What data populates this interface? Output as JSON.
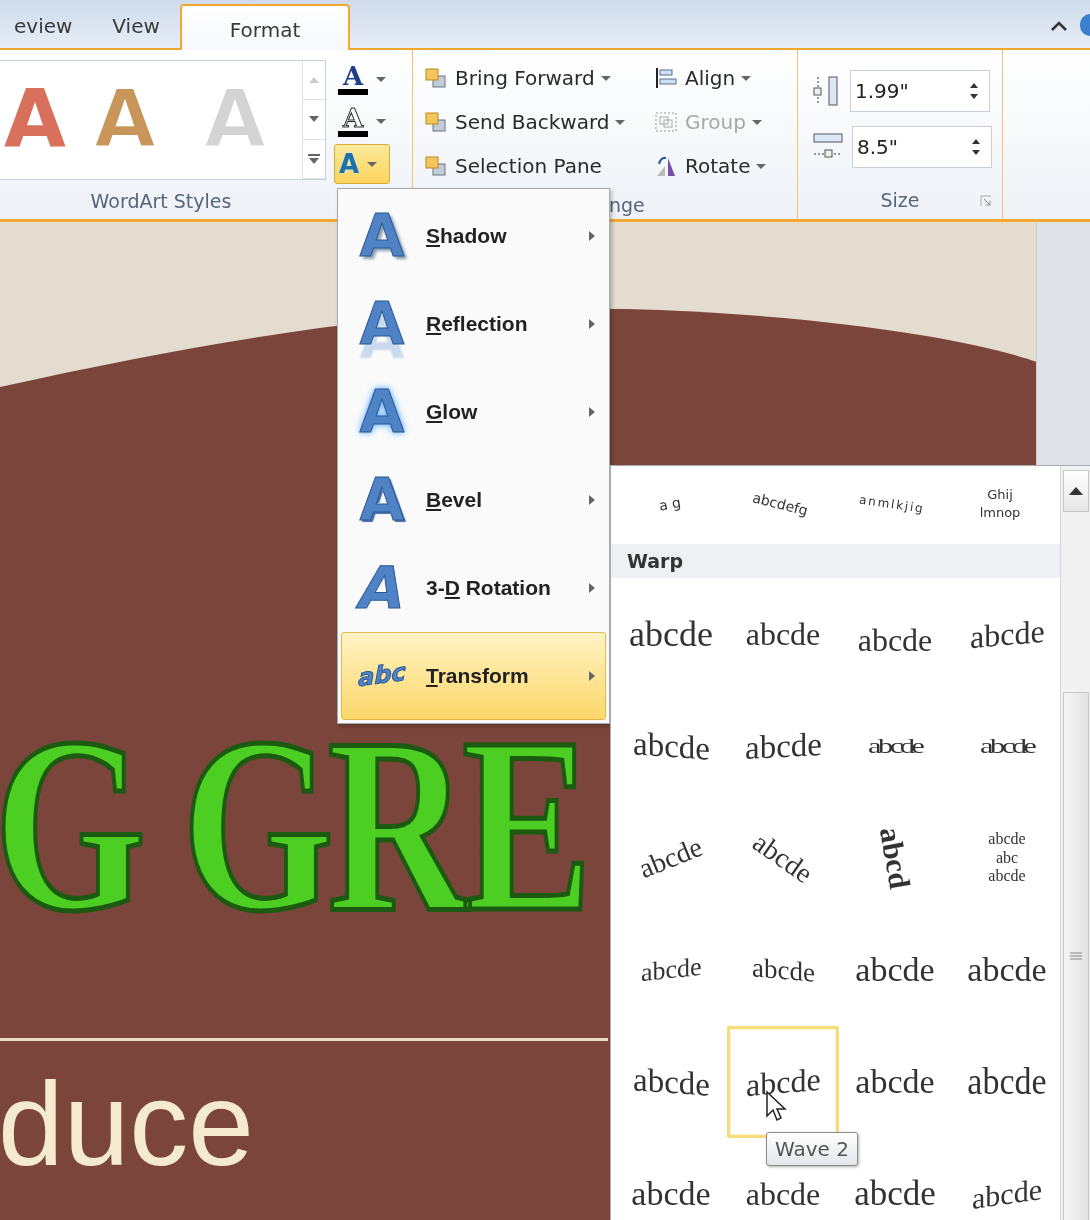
{
  "ribbon_tabs": [
    {
      "label": "eview",
      "selected": false
    },
    {
      "label": "View",
      "selected": false
    },
    {
      "label": "Format",
      "selected": true
    }
  ],
  "wordart_styles": {
    "samples": [
      {
        "glyph": "A",
        "kind": "fill",
        "color": "#d9705c"
      },
      {
        "glyph": "A",
        "kind": "outline",
        "color": "#c8955a"
      },
      {
        "glyph": "A",
        "kind": "outline",
        "color": "#d4d4d4"
      }
    ],
    "text_fill": {
      "glyph": "A"
    },
    "text_outline": {
      "glyph": "A"
    },
    "text_effects": {
      "glyph": "A",
      "expanded": true
    },
    "label": "WordArt Styles"
  },
  "arrange": {
    "buttons": [
      {
        "label": "Bring Forward",
        "kind": "bring-forward",
        "dropdown": true,
        "disabled": false
      },
      {
        "label": "Align",
        "kind": "align",
        "dropdown": true,
        "disabled": false
      },
      {
        "label": "Send Backward",
        "kind": "send-backward",
        "dropdown": true,
        "disabled": false
      },
      {
        "label": "Group",
        "kind": "group",
        "dropdown": true,
        "disabled": true
      },
      {
        "label": "Selection Pane",
        "kind": "selection-pane",
        "dropdown": false,
        "disabled": false
      },
      {
        "label": "Rotate",
        "kind": "rotate",
        "dropdown": true,
        "disabled": false
      }
    ],
    "label": "nge"
  },
  "size": {
    "height": "1.99\"",
    "width": "8.5\"",
    "label": "Size"
  },
  "document": {
    "heading": "G GRE",
    "subtitle": "duce"
  },
  "effects_menu": {
    "items": [
      {
        "key": "S",
        "after": "hadow",
        "glyph": "A",
        "kind": "shadow",
        "selected": false
      },
      {
        "key": "R",
        "after": "eflection",
        "glyph": "A",
        "kind": "reflection",
        "selected": false
      },
      {
        "key": "G",
        "after": "low",
        "glyph": "A",
        "kind": "glow",
        "selected": false
      },
      {
        "key": "B",
        "after": "evel",
        "glyph": "A",
        "kind": "bevel",
        "selected": false
      },
      {
        "before": "3-",
        "key": "D",
        "after": " Rotation",
        "glyph": "A",
        "kind": "rotation",
        "selected": false
      },
      {
        "key": "T",
        "after": "ransform",
        "glyph": "abc",
        "kind": "transform",
        "selected": true
      }
    ]
  },
  "transform_gallery": {
    "path_previews": [
      {
        "lines": [
          "a g"
        ],
        "kind": "arc-down"
      },
      {
        "lines": [
          "abcdefg"
        ],
        "kind": "smile"
      },
      {
        "lines": [
          "a n m l k j i g"
        ],
        "kind": "ring"
      },
      {
        "lines": [
          "Ghij",
          "lmnop"
        ],
        "kind": "ring-two"
      }
    ],
    "section": "Warp",
    "warp_shapes": [
      {
        "lines": [
          "abcde"
        ],
        "kind": "square",
        "selected": false
      },
      {
        "lines": [
          "abcde"
        ],
        "kind": "triangle-up",
        "selected": false
      },
      {
        "lines": [
          "abcde"
        ],
        "kind": "triangle-down",
        "selected": false
      },
      {
        "lines": [
          "abcde"
        ],
        "kind": "chevron-up",
        "selected": false
      },
      {
        "lines": [
          "abcde"
        ],
        "kind": "chevron-down",
        "selected": false
      },
      {
        "lines": [
          "abcde"
        ],
        "kind": "chevron-up-2",
        "selected": false
      },
      {
        "lines": [
          "abcde"
        ],
        "kind": "ring-inside",
        "selected": false
      },
      {
        "lines": [
          "abcde"
        ],
        "kind": "ring-outside",
        "selected": false
      },
      {
        "lines": [
          "abcde"
        ],
        "kind": "arch-up",
        "selected": false
      },
      {
        "lines": [
          "abcde"
        ],
        "kind": "arch-down",
        "selected": false
      },
      {
        "lines": [
          "abcd"
        ],
        "kind": "circle",
        "selected": false
      },
      {
        "lines": [
          "abcde",
          "abc",
          "abcde"
        ],
        "kind": "button",
        "selected": false
      },
      {
        "lines": [
          "abcde"
        ],
        "kind": "can-up",
        "selected": false
      },
      {
        "lines": [
          "abcde"
        ],
        "kind": "can-down",
        "selected": false
      },
      {
        "lines": [
          "abcde"
        ],
        "kind": "curve-up",
        "selected": false
      },
      {
        "lines": [
          "abcde"
        ],
        "kind": "curve-down",
        "selected": false
      },
      {
        "lines": [
          "abcde"
        ],
        "kind": "wave-1",
        "selected": false
      },
      {
        "lines": [
          "abcde"
        ],
        "kind": "wave-2",
        "selected": true
      },
      {
        "lines": [
          "abcde"
        ],
        "kind": "double-wave-1",
        "selected": false
      },
      {
        "lines": [
          "abcde"
        ],
        "kind": "double-wave-2",
        "selected": false
      },
      {
        "lines": [
          "abcde"
        ],
        "kind": "inflate",
        "selected": false
      },
      {
        "lines": [
          "abcde"
        ],
        "kind": "deflate",
        "selected": false
      },
      {
        "lines": [
          "abcde"
        ],
        "kind": "inflate-bottom",
        "selected": false
      },
      {
        "lines": [
          "abcde"
        ],
        "kind": "fade-right",
        "selected": false
      }
    ],
    "tooltip": "Wave 2"
  }
}
